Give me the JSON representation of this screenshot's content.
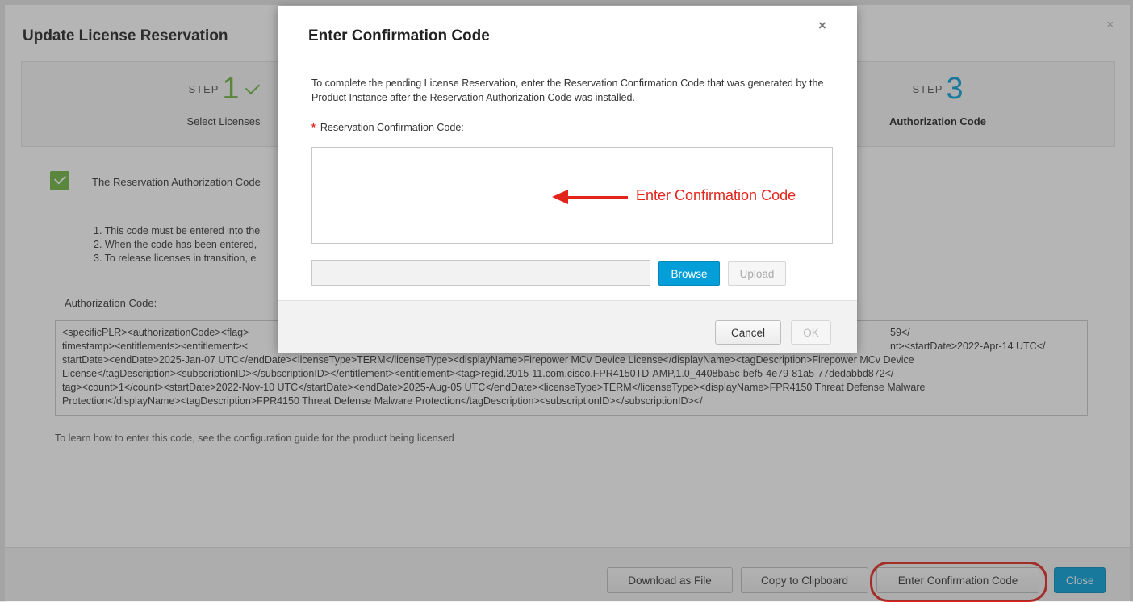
{
  "background_dialog": {
    "title": "Update License Reservation",
    "close_glyph": "×",
    "steps": [
      {
        "word": "STEP",
        "number": "1",
        "label": "Select Licenses",
        "status": "complete"
      },
      {
        "word": "STEP",
        "number": "3",
        "label": "Authorization Code",
        "status": "active"
      }
    ],
    "success_message": "The Reservation Authorization Code",
    "instructions": [
      "1. This code must be entered into the",
      "2. When the code has been entered,",
      "3. To release licenses in transition, e"
    ],
    "authorization_label": "Authorization Code:",
    "authorization_code_lines": [
      "<specificPLR><authorizationCode><flag>",
      "timestamp><entitlements><entitlement><",
      "startDate><endDate>2025-Jan-07 UTC</endDate><licenseType>TERM</licenseType><displayName>Firepower MCv Device License</displayName><tagDescription>Firepower MCv Device",
      "License</tagDescription><subscriptionID></subscriptionID></entitlement><entitlement><tag>regid.2015-11.com.cisco.FPR4150TD-AMP,1.0_4408ba5c-bef5-4e79-81a5-77dedabbd872</",
      "tag><count>1</count><startDate>2022-Nov-10 UTC</startDate><endDate>2025-Aug-05 UTC</endDate><licenseType>TERM</licenseType><displayName>FPR4150 Threat Defense Malware",
      "Protection</displayName><tagDescription>FPR4150 Threat Defense Malware Protection</tagDescription><subscriptionID></subscriptionID></"
    ],
    "authorization_code_right_fragments": [
      "59</",
      "nt><startDate>2022-Apr-14 UTC</"
    ],
    "learn_text": "To learn how to enter this code, see the configuration guide for the product being licensed",
    "footer": {
      "download": "Download as File",
      "copy": "Copy to Clipboard",
      "enter": "Enter Confirmation Code",
      "close": "Close"
    }
  },
  "modal": {
    "title": "Enter Confirmation Code",
    "close_glyph": "×",
    "description": "To complete the pending License Reservation, enter the Reservation Confirmation Code that was generated by the Product Instance after the Reservation Authorization Code was installed.",
    "required_mark": "*",
    "field_label": "Reservation Confirmation Code:",
    "field_value": "",
    "annotation": "Enter Confirmation Code",
    "browse_label": "Browse",
    "upload_label": "Upload",
    "cancel_label": "Cancel",
    "ok_label": "OK"
  },
  "colors": {
    "accent_blue": "#049fd9",
    "success_green": "#6cb33f",
    "annotation_red": "#e3241b"
  }
}
